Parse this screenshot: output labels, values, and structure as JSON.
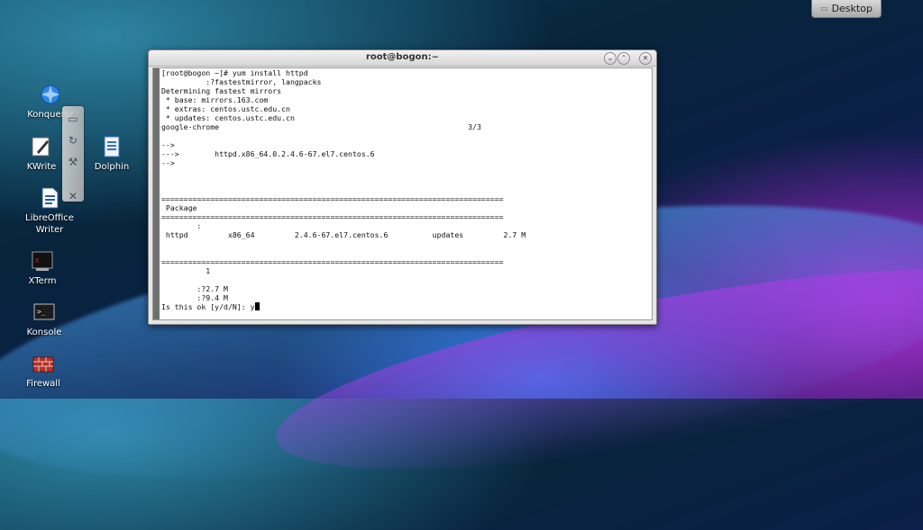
{
  "desktop": {
    "pager_label": "Desktop",
    "icons": [
      {
        "label": "Konqueror",
        "icon": "konqueror-globe-icon"
      },
      {
        "label": "KWrite",
        "icon": "kwrite-pen-icon"
      },
      {
        "label": "Dolphin",
        "icon": "dolphin-file-manager-icon"
      },
      {
        "label": "LibreOffice Writer",
        "icon": "libreoffice-writer-icon"
      },
      {
        "label": "XTerm",
        "icon": "xterm-icon"
      },
      {
        "label": "Konsole",
        "icon": "konsole-icon"
      },
      {
        "label": "Firewall",
        "icon": "firewall-icon"
      }
    ]
  },
  "terminal": {
    "title": "root@bogon:~",
    "lines": [
      "[root@bogon ~]# yum install httpd",
      "          :?fastestmirror, langpacks",
      "Determining fastest mirrors",
      " * base: mirrors.163.com",
      " * extras: centos.ustc.edu.cn",
      " * updates: centos.ustc.edu.cn",
      "google-chrome                                                        3/3",
      "",
      "-->",
      "--->        httpd.x86_64.0.2.4.6-67.el7.centos.6",
      "-->",
      "",
      "",
      "",
      "=============================================================================",
      " Package",
      "=============================================================================",
      "        :",
      " httpd         x86_64         2.4.6-67.el7.centos.6          updates         2.7 M",
      "",
      "",
      "=============================================================================",
      "          1",
      "",
      "        :?2.7 M",
      "        :?9.4 M",
      "Is this ok [y/d/N]: y"
    ]
  }
}
